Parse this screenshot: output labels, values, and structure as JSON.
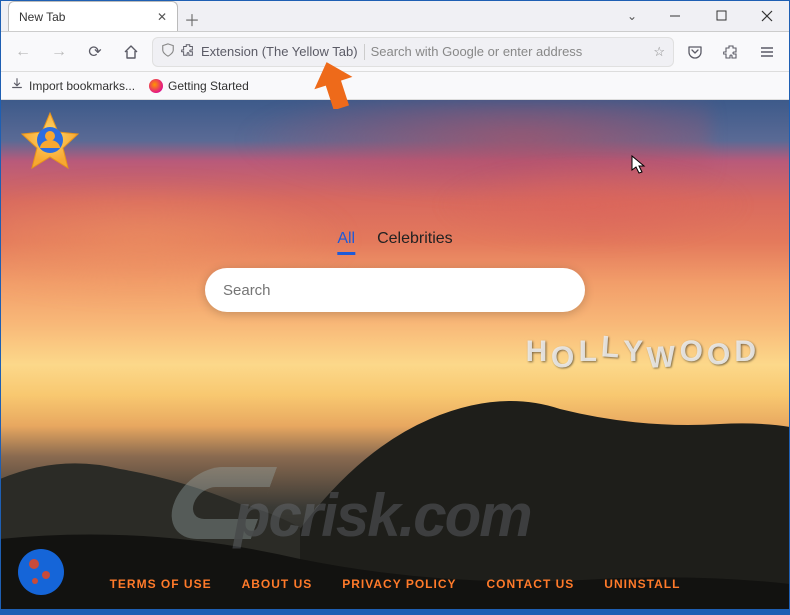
{
  "tab": {
    "title": "New Tab"
  },
  "urlbar": {
    "extension_label": "Extension (The Yellow Tab)",
    "placeholder": "Search with Google or enter address"
  },
  "bookmarks": {
    "import": "Import bookmarks...",
    "getting_started": "Getting Started"
  },
  "page": {
    "nav": {
      "all": "All",
      "celebrities": "Celebrities"
    },
    "search_placeholder": "Search",
    "hollywood": "HOLLYWOOD",
    "footer": {
      "terms": "TERMS OF USE",
      "about": "ABOUT US",
      "privacy": "PRIVACY POLICY",
      "contact": "CONTACT US",
      "uninstall": "UNINSTALL"
    }
  },
  "watermark": "pcrisk.com"
}
